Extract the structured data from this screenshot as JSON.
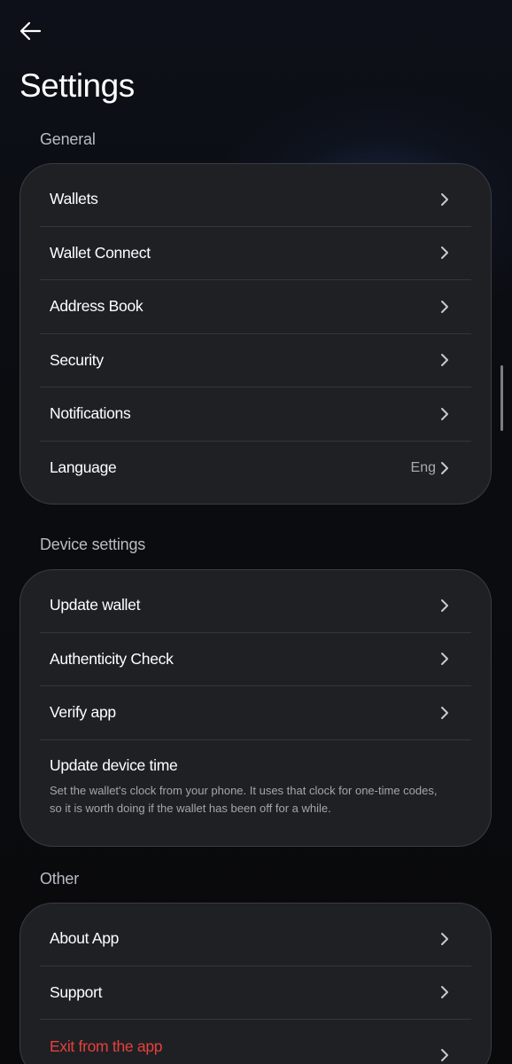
{
  "header": {
    "title": "Settings",
    "back_icon": "arrow-left-icon"
  },
  "sections": {
    "general": {
      "title": "General",
      "items": [
        {
          "label": "Wallets"
        },
        {
          "label": "Wallet Connect"
        },
        {
          "label": "Address Book"
        },
        {
          "label": "Security"
        },
        {
          "label": "Notifications"
        },
        {
          "label": "Language",
          "value": "Eng"
        }
      ]
    },
    "device": {
      "title": "Device settings",
      "items": [
        {
          "label": "Update wallet"
        },
        {
          "label": "Authenticity Check"
        },
        {
          "label": "Verify app"
        },
        {
          "label": "Update device time",
          "description": "Set the wallet's clock from your phone. It uses that clock for one-time codes, so it is worth doing if the wallet has been off for a while."
        }
      ]
    },
    "other": {
      "title": "Other",
      "items": [
        {
          "label": "About App"
        },
        {
          "label": "Support"
        },
        {
          "label": "Exit from the app"
        }
      ]
    }
  },
  "colors": {
    "background": "#0b0c0f",
    "card": "#1f2024",
    "danger": "#e5403c",
    "muted_text": "#a6a9b0"
  }
}
